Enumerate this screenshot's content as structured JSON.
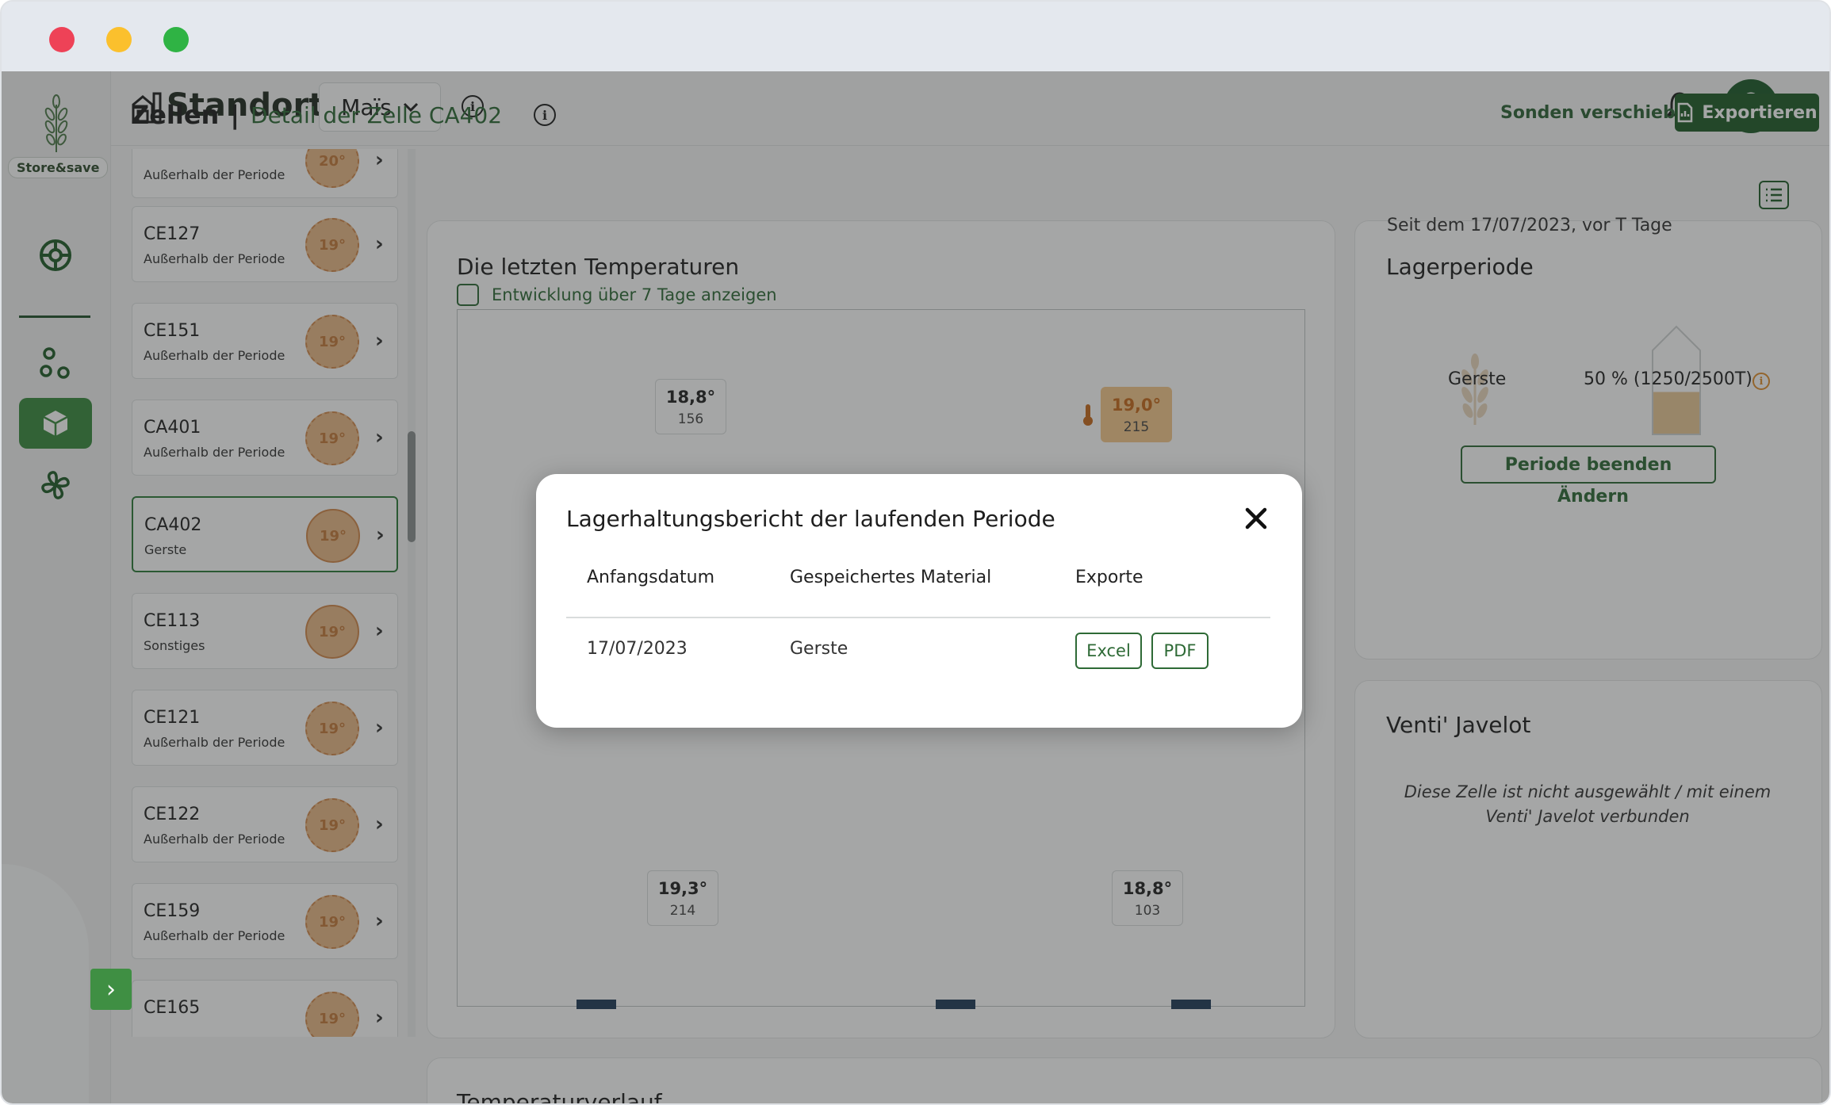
{
  "header": {
    "site_label": "Standort:",
    "site_value": "Maïs",
    "logo_text": "Store&save"
  },
  "breadcrumb": {
    "section": "Zellen",
    "separator": "|",
    "detail": "Detail der Zelle CA402"
  },
  "actions": {
    "move_probes": "Sonden verschieben",
    "export": "Exportieren"
  },
  "cells": [
    {
      "name": "",
      "status": "Außerhalb der Periode",
      "temp": "20°"
    },
    {
      "name": "CE127",
      "status": "Außerhalb der Periode",
      "temp": "19°"
    },
    {
      "name": "CE151",
      "status": "Außerhalb der Periode",
      "temp": "19°"
    },
    {
      "name": "CA401",
      "status": "Außerhalb der Periode",
      "temp": "19°"
    },
    {
      "name": "CA402",
      "status": "Gerste",
      "temp": "19°"
    },
    {
      "name": "CE113",
      "status": "Sonstiges",
      "temp": "19°"
    },
    {
      "name": "CE121",
      "status": "Außerhalb der Periode",
      "temp": "19°"
    },
    {
      "name": "CE122",
      "status": "Außerhalb der Periode",
      "temp": "19°"
    },
    {
      "name": "CE159",
      "status": "Außerhalb der Periode",
      "temp": "19°"
    },
    {
      "name": "CE165",
      "status": "",
      "temp": "19°"
    }
  ],
  "temperatures": {
    "title": "Die letzten Temperaturen",
    "checkbox_label": "Entwicklung über 7 Tage anzeigen",
    "probes": [
      {
        "temp": "18,8°",
        "id": "156"
      },
      {
        "temp": "19,0°",
        "id": "215"
      },
      {
        "temp": "19,3°",
        "id": "214"
      },
      {
        "temp": "18,8°",
        "id": "103"
      }
    ]
  },
  "storage": {
    "title": "Lagerperiode",
    "subtitle": "Seit dem 17/07/2023, vor T Tage",
    "grain": "Gerste",
    "fill_text": "50 % (1250/2500T)",
    "fill_fraction": 0.5,
    "end_button": "Periode beenden",
    "edit_link": "Ändern"
  },
  "venti": {
    "title": "Venti' Javelot",
    "message": "Diese Zelle ist nicht ausgewählt / mit einem Venti' Javelot verbunden"
  },
  "bottom_panel": {
    "title": "Temperaturverlauf"
  },
  "modal": {
    "title": "Lagerhaltungsbericht der laufenden Periode",
    "columns": [
      "Anfangsdatum",
      "Gespeichertes Material",
      "Exporte"
    ],
    "row": {
      "date": "17/07/2023",
      "material": "Gerste"
    },
    "excel_label": "Excel",
    "pdf_label": "PDF"
  },
  "colors": {
    "brand_green": "#1f5c28",
    "accent_green": "#3a8a3f",
    "temp_orange": "#e9b887"
  }
}
